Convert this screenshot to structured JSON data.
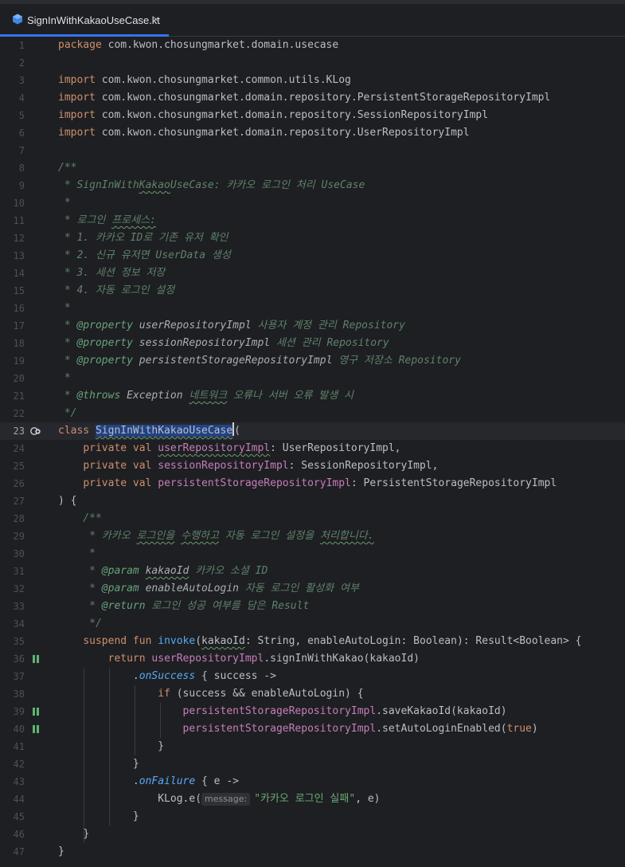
{
  "tab": {
    "filename": "SignInWithKakaoUseCase.kt",
    "close": "×"
  },
  "line_numbers": [
    "1",
    "2",
    "3",
    "4",
    "5",
    "6",
    "7",
    "8",
    "9",
    "10",
    "11",
    "12",
    "13",
    "14",
    "15",
    "16",
    "17",
    "18",
    "19",
    "20",
    "21",
    "22",
    "23",
    "24",
    "25",
    "26",
    "27",
    "28",
    "29",
    "30",
    "31",
    "32",
    "33",
    "34",
    "35",
    "36",
    "37",
    "38",
    "39",
    "40",
    "41",
    "42",
    "43",
    "44",
    "45",
    "46",
    "47"
  ],
  "code": {
    "kw_package": "package",
    "package_name": " com.kwon.chosungmarket.domain.usecase",
    "kw_import": "import",
    "import_1": " com.kwon.chosungmarket.common.utils.KLog",
    "import_2": " com.kwon.chosungmarket.domain.repository.PersistentStorageRepositoryImpl",
    "import_3": " com.kwon.chosungmarket.domain.repository.SessionRepositoryImpl",
    "import_4": " com.kwon.chosungmarket.domain.repository.UserRepositoryImpl",
    "doc_open": "/**",
    "doc9_a": " * SignInWith",
    "doc9_b": "Kakao",
    "doc9_c": "UseCase: 카카오 로그인 처리 UseCase",
    "doc_star": " *",
    "doc11_a": " * 로그인 ",
    "doc11_b": "프로세스:",
    "doc12": " * 1. 카카오 ID로 기존 유저 확인",
    "doc13": " * 2. 신규 유저면 UserData 생성",
    "doc14": " * 3. 세션 정보 저장",
    "doc15": " * 4. 자동 로그인 설정",
    "doc_star_prefix": " * ",
    "tag_property": "@property",
    "tag_throws": "@throws",
    "doc17_ref": " userRepositoryImpl",
    "doc17_txt": " 사용자 계정 관리 Repository",
    "doc18_ref": " sessionRepositoryImpl",
    "doc18_txt": " 세션 관리 Repository",
    "doc19_ref": " persistentStorageRepositoryImpl",
    "doc19_txt": " 영구 저장소 Repository",
    "doc21_ref": " Exception ",
    "doc21_typo": "네트워크",
    "doc21_txt": " 오류나 서버 오류 발생 시",
    "doc_close": " */",
    "kw_class": "class",
    "class_name": "SignInWithKakaoUseCase",
    "paren_open": "(",
    "indent1": "    ",
    "indent2": "        ",
    "indent3": "            ",
    "indent4": "                ",
    "kw_private": "private",
    "kw_val": " val ",
    "p1_name": "userRepositoryImpl",
    "p1_type": ": UserRepositoryImpl,",
    "p2_name": "sessionRepositoryImpl",
    "p2_type": ": SessionRepositoryImpl,",
    "p3_name": "persistentStorageRepositoryImpl",
    "p3_type": ": PersistentStorageRepositoryImpl",
    "class_close": ") {",
    "idoc_open": "    /**",
    "idoc29_a": "     * 카카오 ",
    "idoc29_b": "로그인을",
    "idoc29_c": " ",
    "idoc29_d": "수행하고",
    "idoc29_e": " 자동 로그인 설정을 ",
    "idoc29_f": "처리합니다.",
    "idoc_star": "     *",
    "idoc_prefix": "     * ",
    "tag_param": "@param",
    "tag_return": "@return",
    "idoc31_ref": "kakaoId",
    "idoc31_txt": " 카카오 소셜 ID",
    "idoc32_ref": " enableAutoLogin",
    "idoc32_txt": " 자동 로그인 활성화 여부",
    "idoc33_txt": " 로그인 성공 여부를 담은 Result",
    "idoc_close": "     */",
    "kw_suspend": "suspend",
    "kw_fun": " fun ",
    "fn_invoke": "invoke",
    "sig_open": "(",
    "sig_param1": "kakaoId",
    "sig_rest": ": String, enableAutoLogin: Boolean): Result<Boolean> {",
    "kw_return": "return",
    "l36_rest": ".signInWithKakao(kakaoId)",
    "dot": ".",
    "ext_success": "onSuccess",
    "l37_rest": " { success ->",
    "kw_if": "if",
    "l38_rest": " (success && enableAutoLogin) {",
    "l39_rest": ".saveKakaoId(kakaoId)",
    "l40_rest": ".setAutoLoginEnabled(",
    "kw_true": "true",
    "close_paren": ")",
    "close_brace": "}",
    "ext_failure": "onFailure",
    "l43_rest": " { e ->",
    "l44_call": "KLog.e(",
    "l44_hint": "message:",
    "l44_str": "\"카카오 로그인 실패\"",
    "l44_rest": ", e)",
    "space": " "
  },
  "colors": {
    "background": "#1e1f22",
    "keyword": "#cf8e6d",
    "property": "#c77dbb",
    "function": "#56a8f5",
    "string": "#6aab73",
    "doc_comment": "#5f826b",
    "selection": "#214283",
    "tab_accent": "#3574f0"
  },
  "icons": {
    "tab": "kotlin-file-icon",
    "line23": "implement-gutter-icon",
    "line36": "suspend-call-gutter-icon",
    "line39": "suspend-call-gutter-icon",
    "line40": "suspend-call-gutter-icon"
  }
}
